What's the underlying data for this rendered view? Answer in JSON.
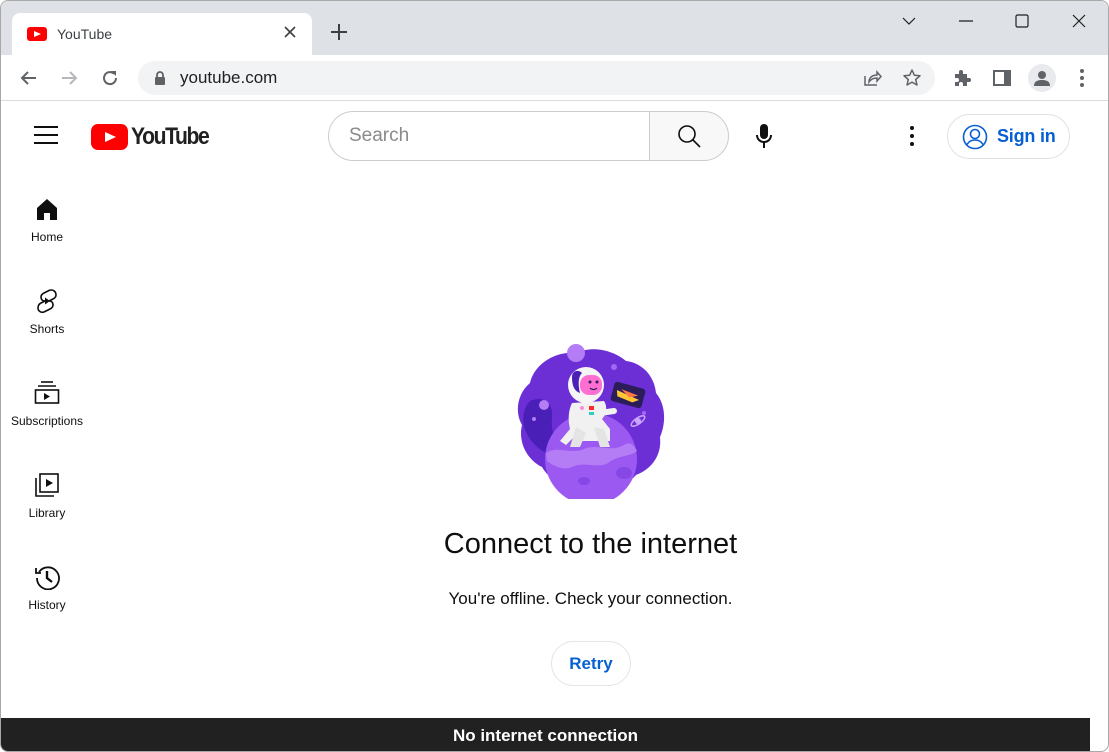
{
  "browser": {
    "tab": {
      "title": "YouTube",
      "favicon": "youtube-favicon",
      "close_icon": "close-icon"
    },
    "new_tab_icon": "plus-icon",
    "window_controls": [
      "tab-search-chevron",
      "minimize",
      "maximize",
      "close"
    ],
    "url": "youtube.com",
    "toolbar_icons": [
      "back-arrow",
      "forward-arrow",
      "reload",
      "lock",
      "share",
      "bookmark-star",
      "extensions-puzzle",
      "side-panel",
      "profile-avatar",
      "chrome-menu-kebab"
    ]
  },
  "header": {
    "logo_text": "YouTube",
    "search": {
      "placeholder": "Search",
      "value": ""
    },
    "signin_label": "Sign in"
  },
  "sidebar": {
    "items": [
      {
        "label": "Home",
        "icon": "home-icon"
      },
      {
        "label": "Shorts",
        "icon": "shorts-icon"
      },
      {
        "label": "Subscriptions",
        "icon": "subscriptions-icon"
      },
      {
        "label": "Library",
        "icon": "library-icon"
      },
      {
        "label": "History",
        "icon": "history-icon"
      }
    ]
  },
  "main": {
    "illustration": "astronaut-on-planet",
    "title": "Connect to the internet",
    "subtitle": "You're offline. Check your connection.",
    "retry_label": "Retry"
  },
  "snackbar": {
    "text": "No internet connection"
  },
  "colors": {
    "brand_red": "#ff0000",
    "link_blue": "#065fd4",
    "tabstrip_bg": "#dee1e6",
    "snackbar_bg": "#212121",
    "illustration_purple": "#6c2fd6"
  }
}
